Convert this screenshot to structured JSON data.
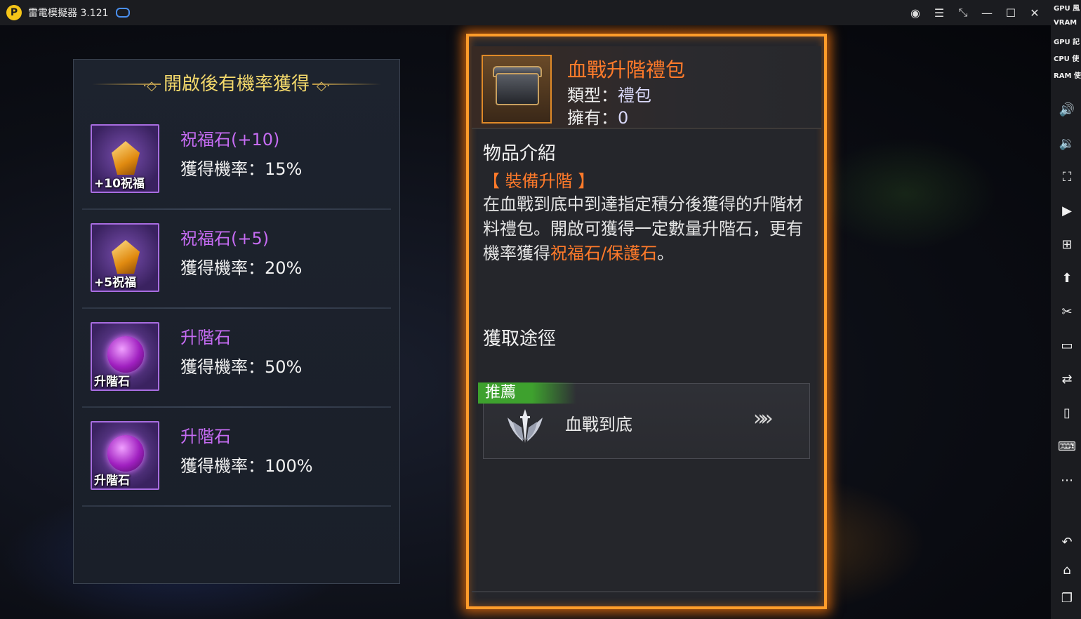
{
  "window": {
    "title": "雷電模擬器 3.121"
  },
  "perf": {
    "gpu": "GPU 風",
    "vram": "VRAM",
    "gpu2": "GPU 記",
    "cpu": "CPU 使",
    "ram": "RAM 使"
  },
  "left_panel": {
    "title": "開啟後有機率獲得",
    "items": [
      {
        "name": "祝福石(+10)",
        "rate": "獲得機率：15%",
        "tag": "+10祝福"
      },
      {
        "name": "祝福石(+5)",
        "rate": "獲得機率：20%",
        "tag": "+5祝福"
      },
      {
        "name": "升階石",
        "rate": "獲得機率：50%",
        "tag": "升階石"
      },
      {
        "name": "升階石",
        "rate": "獲得機率：100%",
        "tag": "升階石"
      }
    ]
  },
  "right_panel": {
    "name": "血戰升階禮包",
    "type_label": "類型：",
    "type_value": "禮包",
    "own_label": "擁有：",
    "own_value": "0",
    "intro_title": "物品介紹",
    "tag": "【 裝備升階 】",
    "desc_part1": "在血戰到底中到達指定積分後獲得的升階材料禮包。開啟可獲得一定數量升階石，更有機率獲得",
    "desc_highlight": "祝福石/保護石",
    "desc_part2": "。",
    "route_title": "獲取途徑",
    "route_badge": "推薦",
    "route_name": "血戰到底",
    "route_arrows": "»»"
  },
  "colors": {
    "accent_orange": "#ff7a2a",
    "frame_orange": "#ff9c2a",
    "purple_text": "#c66cf3",
    "gold_title": "#f3d86b",
    "badge_green": "#3ea12e"
  }
}
